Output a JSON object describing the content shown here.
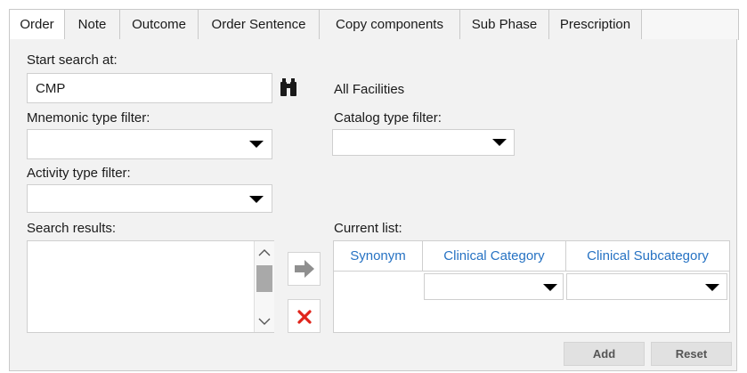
{
  "tabs": [
    {
      "label": "Order",
      "active": true
    },
    {
      "label": "Note",
      "active": false
    },
    {
      "label": "Outcome",
      "active": false
    },
    {
      "label": "Order Sentence",
      "active": false
    },
    {
      "label": "Copy components",
      "active": false
    },
    {
      "label": "Sub Phase",
      "active": false
    },
    {
      "label": "Prescription",
      "active": false
    }
  ],
  "search": {
    "start_label": "Start search at:",
    "value": "CMP",
    "search_icon": "binoculars-icon",
    "facility": "All Facilities"
  },
  "filters": {
    "mnemonic_label": "Mnemonic type filter:",
    "mnemonic_value": "",
    "catalog_label": "Catalog type filter:",
    "catalog_value": "",
    "activity_label": "Activity type filter:",
    "activity_value": ""
  },
  "results": {
    "label": "Search results:",
    "items": []
  },
  "transfer": {
    "add_icon": "arrow-right-icon",
    "remove_icon": "red-x-icon"
  },
  "current_list": {
    "label": "Current list:",
    "columns": [
      "Synonym",
      "Clinical Category",
      "Clinical Subcategory"
    ],
    "rows": [
      {
        "synonym": "",
        "category": "",
        "subcategory": ""
      }
    ]
  },
  "buttons": {
    "add": "Add",
    "reset": "Reset"
  },
  "colors": {
    "header_text": "#2672c3",
    "remove_x": "#e0241b",
    "arrow": "#8f8f8f"
  }
}
